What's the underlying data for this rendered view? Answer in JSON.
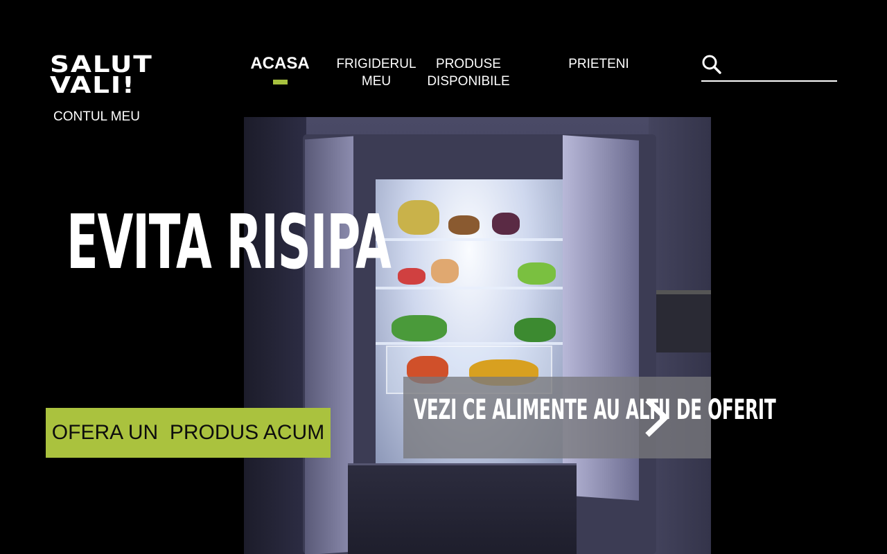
{
  "header": {
    "greeting": "SALUT VALI!",
    "account_link": "CONTUL MEU"
  },
  "nav": {
    "items": [
      {
        "label": "ACASA",
        "active": true
      },
      {
        "label": "FRIGIDERUL MEU",
        "active": false
      },
      {
        "label": "PRODUSE DISPONIBILE",
        "active": false
      },
      {
        "label": "PRIETENI",
        "active": false
      }
    ]
  },
  "search": {
    "icon": "search-icon",
    "placeholder": "",
    "value": ""
  },
  "hero": {
    "title": "EVITA RISIPA",
    "image_alt": "open-fridge-photo",
    "cta_label": "OFERA UN  PRODUS ACUM",
    "browse_label": "VEZI CE ALIMENTE AU ALTII DE OFERIT",
    "browse_icon": "chevron-right-icon"
  },
  "colors": {
    "accent": "#aac23e",
    "background": "#000000",
    "text": "#ffffff",
    "overlay": "#78787c"
  }
}
